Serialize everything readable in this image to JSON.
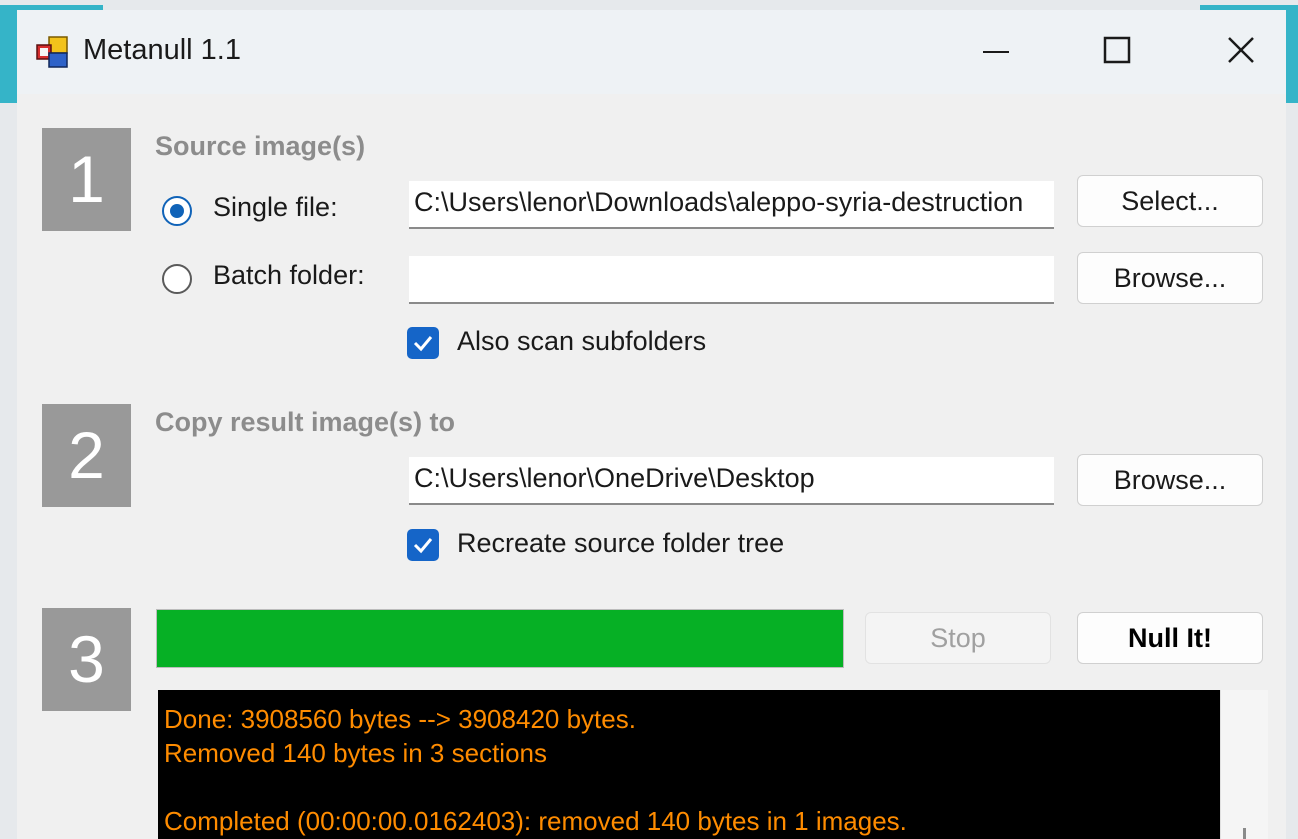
{
  "window": {
    "title": "Metanull 1.1",
    "controls": {
      "minimize": "minimize-icon",
      "maximize": "maximize-icon",
      "close": "close-icon"
    }
  },
  "step1": {
    "number": "1",
    "title": "Source image(s)",
    "single_file": {
      "label": "Single file:",
      "selected": true,
      "value": "C:\\Users\\lenor\\Downloads\\aleppo-syria-destruction"
    },
    "batch_folder": {
      "label": "Batch folder:",
      "selected": false,
      "value": ""
    },
    "select_button": "Select...",
    "browse_button": "Browse...",
    "scan_subfolders": {
      "label": "Also scan subfolders",
      "checked": true
    }
  },
  "step2": {
    "number": "2",
    "title": "Copy result image(s) to",
    "destination": "C:\\Users\\lenor\\OneDrive\\Desktop",
    "browse_button": "Browse...",
    "recreate_tree": {
      "label": "Recreate source folder tree",
      "checked": true
    }
  },
  "step3": {
    "number": "3",
    "progress": 1.0,
    "progress_color": "#06b025",
    "stop_button": "Stop",
    "stop_enabled": false,
    "null_button": "Null It!",
    "log": [
      "Done: 3908560 bytes --> 3908420 bytes.",
      "Removed 140 bytes in 3 sections",
      "",
      "Completed (00:00:00.0162403): removed 140 bytes in 1 images."
    ],
    "log_text_color": "#ff8c00"
  }
}
